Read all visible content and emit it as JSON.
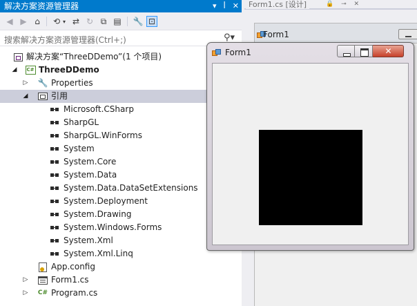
{
  "solution_explorer": {
    "title": "解决方案资源管理器",
    "title_buttons": [
      "▾",
      "ꟾ",
      "✕"
    ],
    "search_placeholder": "搜索解决方案资源管理器(Ctrl+;)",
    "tree": [
      {
        "id": "solution",
        "label": "解决方案“ThreeDDemo”(1 个项目)",
        "icon": "solution-icon",
        "depth": 0,
        "arrow": "",
        "bold": false
      },
      {
        "id": "project",
        "label": "ThreeDDemo",
        "icon": "csharp-project-icon",
        "depth": 0,
        "arrow": "expanded",
        "bold": true
      },
      {
        "id": "properties",
        "label": "Properties",
        "icon": "wrench-icon",
        "depth": 1,
        "arrow": "collapsed",
        "bold": false
      },
      {
        "id": "references",
        "label": "引用",
        "icon": "references-folder-icon",
        "depth": 1,
        "arrow": "expanded",
        "bold": false,
        "selected": true
      },
      {
        "id": "ref-1",
        "label": "Microsoft.CSharp",
        "icon": "reference-icon",
        "depth": 2,
        "arrow": "",
        "bold": false
      },
      {
        "id": "ref-2",
        "label": "SharpGL",
        "icon": "reference-icon",
        "depth": 2,
        "arrow": "",
        "bold": false
      },
      {
        "id": "ref-3",
        "label": "SharpGL.WinForms",
        "icon": "reference-icon",
        "depth": 2,
        "arrow": "",
        "bold": false
      },
      {
        "id": "ref-4",
        "label": "System",
        "icon": "reference-icon",
        "depth": 2,
        "arrow": "",
        "bold": false
      },
      {
        "id": "ref-5",
        "label": "System.Core",
        "icon": "reference-icon",
        "depth": 2,
        "arrow": "",
        "bold": false
      },
      {
        "id": "ref-6",
        "label": "System.Data",
        "icon": "reference-icon",
        "depth": 2,
        "arrow": "",
        "bold": false
      },
      {
        "id": "ref-7",
        "label": "System.Data.DataSetExtensions",
        "icon": "reference-icon",
        "depth": 2,
        "arrow": "",
        "bold": false
      },
      {
        "id": "ref-8",
        "label": "System.Deployment",
        "icon": "reference-icon",
        "depth": 2,
        "arrow": "",
        "bold": false
      },
      {
        "id": "ref-9",
        "label": "System.Drawing",
        "icon": "reference-icon",
        "depth": 2,
        "arrow": "",
        "bold": false
      },
      {
        "id": "ref-10",
        "label": "System.Windows.Forms",
        "icon": "reference-icon",
        "depth": 2,
        "arrow": "",
        "bold": false
      },
      {
        "id": "ref-11",
        "label": "System.Xml",
        "icon": "reference-icon",
        "depth": 2,
        "arrow": "",
        "bold": false
      },
      {
        "id": "ref-12",
        "label": "System.Xml.Linq",
        "icon": "reference-icon",
        "depth": 2,
        "arrow": "",
        "bold": false
      },
      {
        "id": "app-config",
        "label": "App.config",
        "icon": "config-file-icon",
        "depth": 1,
        "arrow": "",
        "bold": false
      },
      {
        "id": "form1",
        "label": "Form1.cs",
        "icon": "form-file-icon",
        "depth": 1,
        "arrow": "collapsed",
        "bold": false
      },
      {
        "id": "program",
        "label": "Program.cs",
        "icon": "csharp-file-icon",
        "depth": 1,
        "arrow": "collapsed",
        "bold": false
      }
    ]
  },
  "designer": {
    "tab_label": "Form1.cs [设计]",
    "tab_icons": "🔒 ⊸ ✕",
    "form_caption": "Form1"
  },
  "running_window": {
    "title": "Form1"
  },
  "colors": {
    "accent": "#007acc",
    "selection": "#cccedb",
    "gl_surface": "#000000"
  }
}
